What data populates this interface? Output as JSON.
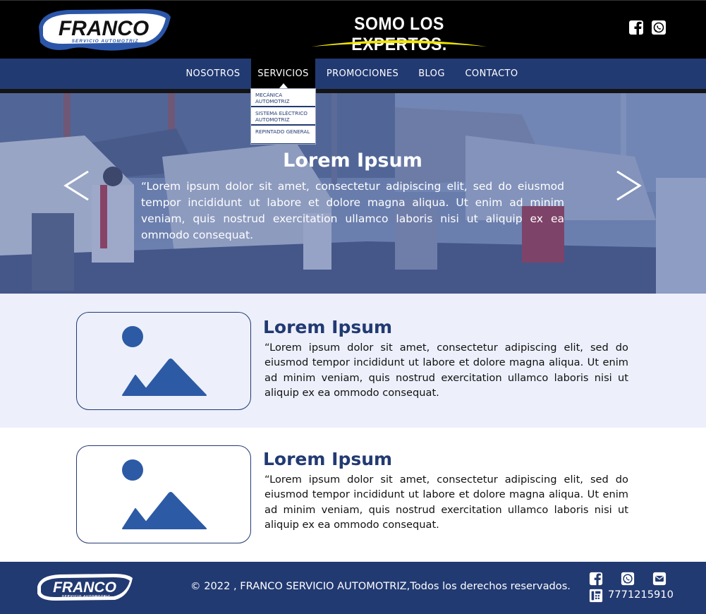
{
  "brand": {
    "name": "FRANCO",
    "tagline": "SERVICIO AUTOMOTRIZ",
    "slogan": "SOMO LOS EXPERTOS."
  },
  "nav": {
    "items": [
      {
        "label": "NOSOTROS"
      },
      {
        "label": "SERVICIOS"
      },
      {
        "label": "PROMOCIONES"
      },
      {
        "label": "BLOG"
      },
      {
        "label": "CONTACTO"
      }
    ],
    "dropdown": [
      {
        "label": "MECÁNICA AUTOMOTRIZ"
      },
      {
        "label": "SISTEMA ELÉCTRICO AUTOMOTRIZ"
      },
      {
        "label": "REPINTADO GENERAL"
      }
    ]
  },
  "hero": {
    "title": "Lorem Ipsum",
    "text": "“Lorem ipsum dolor sit amet, consectetur adipiscing elit, sed do eiusmod tempor incididunt ut labore et dolore magna aliqua. Ut enim ad minim veniam, quis nostrud exercitation ullamco laboris nisi ut aliquip ex ea ommodo consequat."
  },
  "features": [
    {
      "title": "Lorem Ipsum",
      "text": "“Lorem ipsum dolor sit amet, consectetur adipiscing elit, sed do eiusmod tempor incididunt ut labore et dolore magna aliqua. Ut enim ad minim veniam, quis nostrud exercitation ullamco laboris nisi ut aliquip ex ea ommodo consequat."
    },
    {
      "title": "Lorem Ipsum",
      "text": "“Lorem ipsum dolor sit amet, consectetur adipiscing elit, sed do eiusmod tempor incididunt ut labore et dolore magna aliqua. Ut enim ad minim veniam, quis nostrud exercitation ullamco laboris nisi ut aliquip ex ea ommodo consequat."
    }
  ],
  "footer": {
    "copyright": "© 2022 , FRANCO SERVICIO AUTOMOTRIZ,Todos los derechos reservados.",
    "phone": "7771215910"
  },
  "icons": {
    "facebook": "facebook-icon",
    "whatsapp": "whatsapp-icon",
    "mail": "mail-icon",
    "phone": "phone-icon",
    "prev": "chevron-left-icon",
    "next": "chevron-right-icon",
    "image_placeholder": "image-placeholder-icon"
  },
  "colors": {
    "header_bg": "#000000",
    "nav_bg": "#223a72",
    "accent_yellow": "#f2e600",
    "section_alt_bg": "#edf0fb",
    "icon_blue": "#2d5aa5",
    "footer_bg": "#223a72"
  }
}
